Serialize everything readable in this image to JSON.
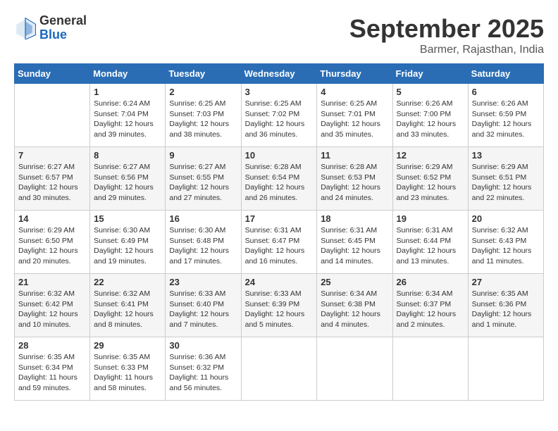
{
  "logo": {
    "general": "General",
    "blue": "Blue"
  },
  "title": "September 2025",
  "subtitle": "Barmer, Rajasthan, India",
  "days_of_week": [
    "Sunday",
    "Monday",
    "Tuesday",
    "Wednesday",
    "Thursday",
    "Friday",
    "Saturday"
  ],
  "weeks": [
    [
      {
        "day": "",
        "info": ""
      },
      {
        "day": "1",
        "info": "Sunrise: 6:24 AM\nSunset: 7:04 PM\nDaylight: 12 hours\nand 39 minutes."
      },
      {
        "day": "2",
        "info": "Sunrise: 6:25 AM\nSunset: 7:03 PM\nDaylight: 12 hours\nand 38 minutes."
      },
      {
        "day": "3",
        "info": "Sunrise: 6:25 AM\nSunset: 7:02 PM\nDaylight: 12 hours\nand 36 minutes."
      },
      {
        "day": "4",
        "info": "Sunrise: 6:25 AM\nSunset: 7:01 PM\nDaylight: 12 hours\nand 35 minutes."
      },
      {
        "day": "5",
        "info": "Sunrise: 6:26 AM\nSunset: 7:00 PM\nDaylight: 12 hours\nand 33 minutes."
      },
      {
        "day": "6",
        "info": "Sunrise: 6:26 AM\nSunset: 6:59 PM\nDaylight: 12 hours\nand 32 minutes."
      }
    ],
    [
      {
        "day": "7",
        "info": "Sunrise: 6:27 AM\nSunset: 6:57 PM\nDaylight: 12 hours\nand 30 minutes."
      },
      {
        "day": "8",
        "info": "Sunrise: 6:27 AM\nSunset: 6:56 PM\nDaylight: 12 hours\nand 29 minutes."
      },
      {
        "day": "9",
        "info": "Sunrise: 6:27 AM\nSunset: 6:55 PM\nDaylight: 12 hours\nand 27 minutes."
      },
      {
        "day": "10",
        "info": "Sunrise: 6:28 AM\nSunset: 6:54 PM\nDaylight: 12 hours\nand 26 minutes."
      },
      {
        "day": "11",
        "info": "Sunrise: 6:28 AM\nSunset: 6:53 PM\nDaylight: 12 hours\nand 24 minutes."
      },
      {
        "day": "12",
        "info": "Sunrise: 6:29 AM\nSunset: 6:52 PM\nDaylight: 12 hours\nand 23 minutes."
      },
      {
        "day": "13",
        "info": "Sunrise: 6:29 AM\nSunset: 6:51 PM\nDaylight: 12 hours\nand 22 minutes."
      }
    ],
    [
      {
        "day": "14",
        "info": "Sunrise: 6:29 AM\nSunset: 6:50 PM\nDaylight: 12 hours\nand 20 minutes."
      },
      {
        "day": "15",
        "info": "Sunrise: 6:30 AM\nSunset: 6:49 PM\nDaylight: 12 hours\nand 19 minutes."
      },
      {
        "day": "16",
        "info": "Sunrise: 6:30 AM\nSunset: 6:48 PM\nDaylight: 12 hours\nand 17 minutes."
      },
      {
        "day": "17",
        "info": "Sunrise: 6:31 AM\nSunset: 6:47 PM\nDaylight: 12 hours\nand 16 minutes."
      },
      {
        "day": "18",
        "info": "Sunrise: 6:31 AM\nSunset: 6:45 PM\nDaylight: 12 hours\nand 14 minutes."
      },
      {
        "day": "19",
        "info": "Sunrise: 6:31 AM\nSunset: 6:44 PM\nDaylight: 12 hours\nand 13 minutes."
      },
      {
        "day": "20",
        "info": "Sunrise: 6:32 AM\nSunset: 6:43 PM\nDaylight: 12 hours\nand 11 minutes."
      }
    ],
    [
      {
        "day": "21",
        "info": "Sunrise: 6:32 AM\nSunset: 6:42 PM\nDaylight: 12 hours\nand 10 minutes."
      },
      {
        "day": "22",
        "info": "Sunrise: 6:32 AM\nSunset: 6:41 PM\nDaylight: 12 hours\nand 8 minutes."
      },
      {
        "day": "23",
        "info": "Sunrise: 6:33 AM\nSunset: 6:40 PM\nDaylight: 12 hours\nand 7 minutes."
      },
      {
        "day": "24",
        "info": "Sunrise: 6:33 AM\nSunset: 6:39 PM\nDaylight: 12 hours\nand 5 minutes."
      },
      {
        "day": "25",
        "info": "Sunrise: 6:34 AM\nSunset: 6:38 PM\nDaylight: 12 hours\nand 4 minutes."
      },
      {
        "day": "26",
        "info": "Sunrise: 6:34 AM\nSunset: 6:37 PM\nDaylight: 12 hours\nand 2 minutes."
      },
      {
        "day": "27",
        "info": "Sunrise: 6:35 AM\nSunset: 6:36 PM\nDaylight: 12 hours\nand 1 minute."
      }
    ],
    [
      {
        "day": "28",
        "info": "Sunrise: 6:35 AM\nSunset: 6:34 PM\nDaylight: 11 hours\nand 59 minutes."
      },
      {
        "day": "29",
        "info": "Sunrise: 6:35 AM\nSunset: 6:33 PM\nDaylight: 11 hours\nand 58 minutes."
      },
      {
        "day": "30",
        "info": "Sunrise: 6:36 AM\nSunset: 6:32 PM\nDaylight: 11 hours\nand 56 minutes."
      },
      {
        "day": "",
        "info": ""
      },
      {
        "day": "",
        "info": ""
      },
      {
        "day": "",
        "info": ""
      },
      {
        "day": "",
        "info": ""
      }
    ]
  ]
}
